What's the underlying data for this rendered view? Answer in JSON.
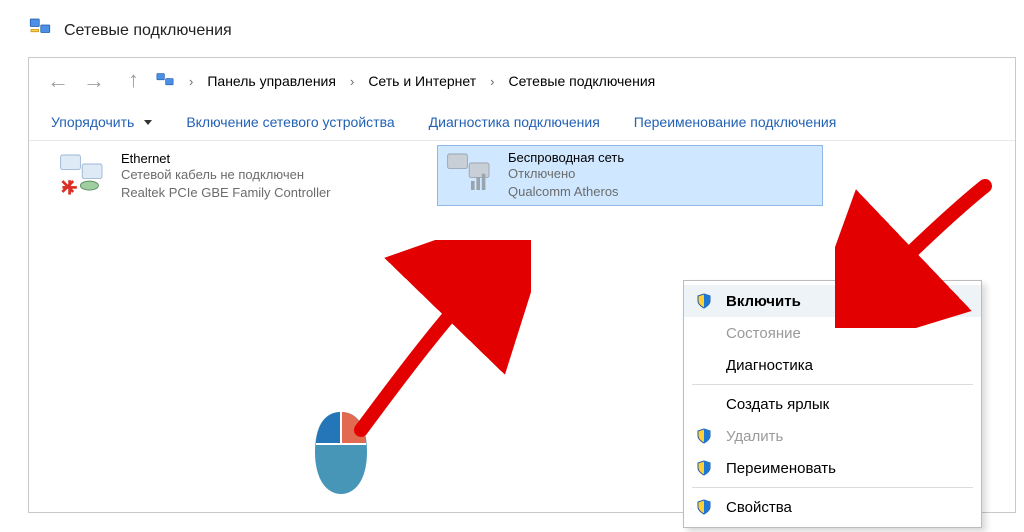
{
  "title": "Сетевые подключения",
  "breadcrumb": {
    "item1": "Панель управления",
    "item2": "Сеть и Интернет",
    "item3": "Сетевые подключения"
  },
  "toolbar": {
    "organize": "Упорядочить",
    "enable_device": "Включение сетевого устройства",
    "diagnose": "Диагностика подключения",
    "rename": "Переименование подключения"
  },
  "connections": {
    "ethernet": {
      "name": "Ethernet",
      "status": "Сетевой кабель не подключен",
      "adapter": "Realtek PCIe GBE Family Controller"
    },
    "wifi": {
      "name": "Беспроводная сеть",
      "status": "Отключено",
      "adapter": "Qualcomm Atheros"
    }
  },
  "context_menu": {
    "enable": "Включить",
    "state": "Состояние",
    "diagnose": "Диагностика",
    "shortcut": "Создать ярлык",
    "delete": "Удалить",
    "rename": "Переименовать",
    "properties": "Свойства"
  }
}
